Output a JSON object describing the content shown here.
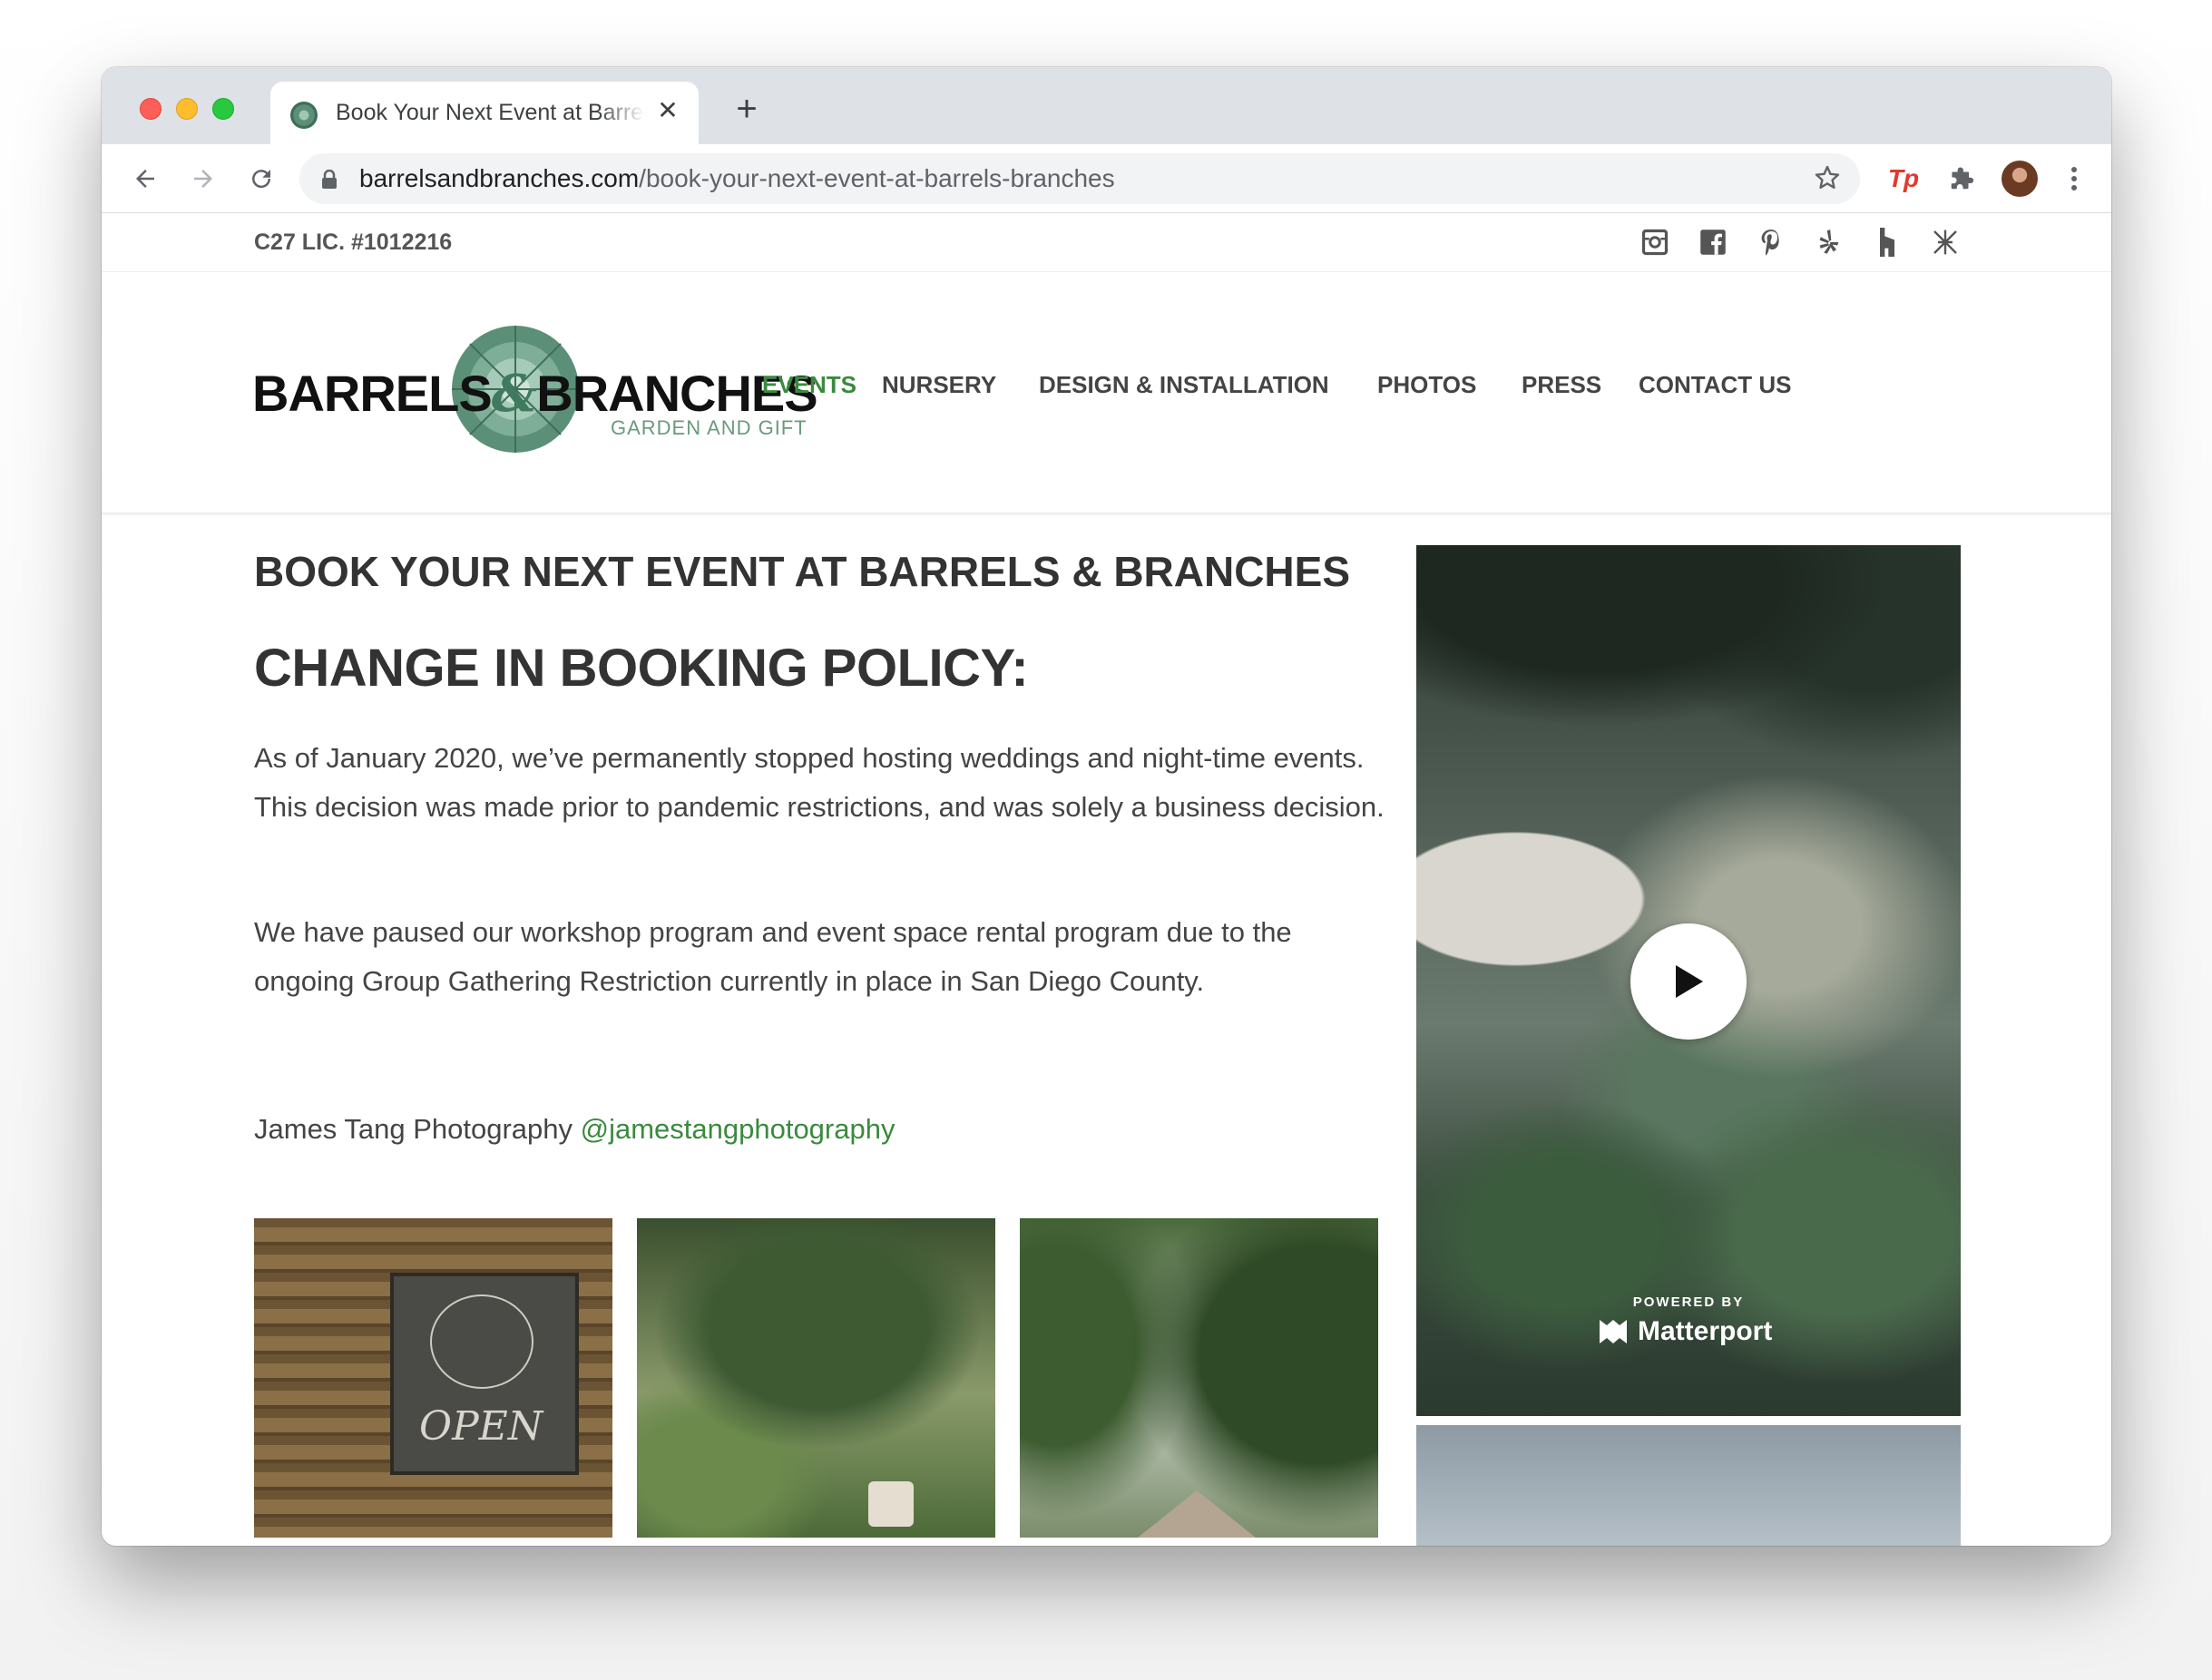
{
  "browser": {
    "tab_title": "Book Your Next Event at Barrels & Branches",
    "tab_close": "✕",
    "new_tab": "+",
    "url_host": "barrelsandbranches.com",
    "url_path": "/book-your-next-event-at-barrels-branches",
    "extension_label": "Tp"
  },
  "site": {
    "license": "C27 LIC. #1012216",
    "logo_text_left": "BARRELS",
    "logo_amp": "&",
    "logo_text_right": "BRANCHES",
    "logo_sub": "GARDEN AND GIFT",
    "nav": [
      "EVENTS",
      "NURSERY",
      "DESIGN & INSTALLATION",
      "PHOTOS",
      "PRESS",
      "CONTACT US"
    ],
    "social_icons": [
      "instagram-icon",
      "facebook-icon",
      "pinterest-icon",
      "yelp-icon",
      "houzz-icon",
      "thumbtack-icon"
    ]
  },
  "content": {
    "title": "BOOK YOUR NEXT EVENT AT BARRELS & BRANCHES",
    "subtitle": "CHANGE IN BOOKING POLICY:",
    "paragraph1": "As of January 2020, we’ve permanently stopped hosting weddings and night-time events.  This decision was made prior to pandemic restrictions, and was solely a business decision.",
    "paragraph2": "We have paused our workshop program and event space rental program due to the ongoing Group Gathering Restriction currently in place in San Diego County.",
    "credit_text": "James Tang Photography ",
    "credit_handle": "@jamestangphotography",
    "sign_text": "OPEN"
  },
  "video": {
    "powered_by": "POWERED BY",
    "brand": "Matterport"
  },
  "colors": {
    "accent_green": "#3a8a3e",
    "tab_strip": "#dee1e6"
  }
}
